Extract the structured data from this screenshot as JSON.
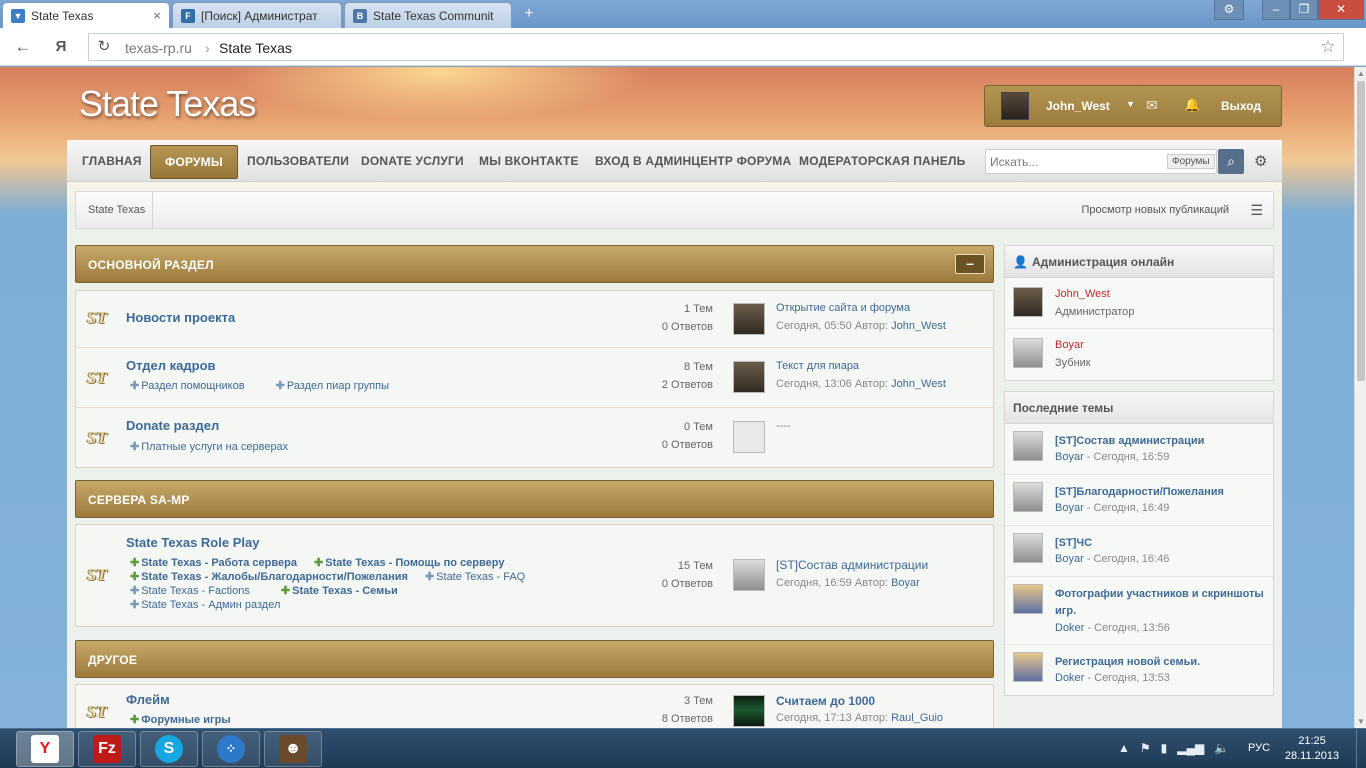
{
  "browser": {
    "tabs": [
      {
        "label": "State Texas",
        "favicon": "site-icon",
        "color": "#3d7fc4"
      },
      {
        "label": "[Поиск] Администрат",
        "favicon": "forum-icon",
        "color": "#2f6ea6"
      },
      {
        "label": "State Texas Communit",
        "favicon": "vk-icon",
        "color": "#4e76a6"
      }
    ],
    "url_host": "texas-rp.ru",
    "url_separator": "›",
    "url_title": "State Texas"
  },
  "site": {
    "logo": "State Texas"
  },
  "user": {
    "name": "John_West",
    "logout": "Выход"
  },
  "nav": {
    "items": [
      "ГЛАВНАЯ",
      "ФОРУМЫ",
      "ПОЛЬЗОВАТЕЛИ",
      "DONATE УСЛУГИ",
      "МЫ ВКОНТАКТЕ",
      "ВХОД В АДМИНЦЕНТР ФОРУМА",
      "МОДЕРАТОРСКАЯ ПАНЕЛЬ"
    ],
    "active_index": 1,
    "search_placeholder": "Искать...",
    "search_scope": "Форумы"
  },
  "breadcrumb": {
    "home": "State Texas",
    "new_posts": "Просмотр новых публикаций"
  },
  "categories": [
    {
      "title": "ОСНОВНОЙ РАЗДЕЛ",
      "collapse": "–",
      "forums": [
        {
          "icon": "ST",
          "title": "Новости проекта",
          "subforums": [],
          "topics": "1 Тем",
          "replies": "0 Ответов",
          "last_title": "Открытие сайта и форума",
          "last_time": "Сегодня, 05:50",
          "last_author_label": "Автор:",
          "last_author": "John_West"
        },
        {
          "icon": "ST",
          "title": "Отдел кадров",
          "subforums": [
            "Раздел помощников",
            "Раздел пиар группы"
          ],
          "topics": "8 Тем",
          "replies": "2 Ответов",
          "last_title": "Текст для пиара",
          "last_time": "Сегодня, 13:06",
          "last_author_label": "Автор:",
          "last_author": "John_West"
        },
        {
          "icon": "ST",
          "title": "Donate раздел",
          "subforums": [
            "Платные услуги на серверах"
          ],
          "topics": "0 Тем",
          "replies": "0 Ответов",
          "last_title": "----"
        }
      ]
    },
    {
      "title": "СЕРВЕРА SA-MP",
      "forums": [
        {
          "icon": "ST",
          "title": "State Texas Role Play",
          "subforums": [
            "State Texas - Работа сервера",
            "State Texas - Помощь по серверу",
            "State Texas - Жалобы/Благодарности/Пожелания",
            "State Texas - FAQ",
            "State Texas - Factions",
            "State Texas - Семьи",
            "State Texas - Админ раздел"
          ],
          "topics": "15 Тем",
          "replies": "0 Ответов",
          "last_title": "[ST]Состав администрации",
          "last_time": "Сегодня, 16:59",
          "last_author_label": "Автор:",
          "last_author": "Boyar"
        }
      ]
    },
    {
      "title": "ДРУГОЕ",
      "forums": [
        {
          "icon": "ST",
          "title": "Флейм",
          "subforums": [
            "Форумные игры"
          ],
          "topics": "3 Тем",
          "replies": "8 Ответов",
          "last_title": "Считаем до 1000",
          "last_time": "Сегодня, 17:13",
          "last_author_label": "Автор:",
          "last_author": "Raul_Guio"
        }
      ]
    }
  ],
  "sidebar": {
    "admins_title": "Администрация онлайн",
    "admins": [
      {
        "name": "John_West",
        "role": "Администратор"
      },
      {
        "name": "Boyar",
        "role": "Зубник"
      }
    ],
    "latest_title": "Последние темы",
    "latest": [
      {
        "title": "[ST]Состав администрации",
        "author": "Boyar",
        "time": "Сегодня, 16:59"
      },
      {
        "title": "[ST]Благодарности/Пожелания",
        "author": "Boyar",
        "time": "Сегодня, 16:49"
      },
      {
        "title": "[ST]ЧС",
        "author": "Boyar",
        "time": "Сегодня, 16:46"
      },
      {
        "title": "Фотографии участников и скриншоты игр.",
        "author": "Doker",
        "time": "Сегодня, 13:56"
      },
      {
        "title": "Регистрация новой семьи.",
        "author": "Doker",
        "time": "Сегодня, 13:53"
      }
    ]
  },
  "taskbar": {
    "apps": [
      "yandex-browser-icon",
      "filezilla-icon",
      "skype-icon",
      "hub-icon",
      "gta-icon"
    ],
    "lang": "РУС",
    "time": "21:25",
    "date": "28.11.2013"
  }
}
